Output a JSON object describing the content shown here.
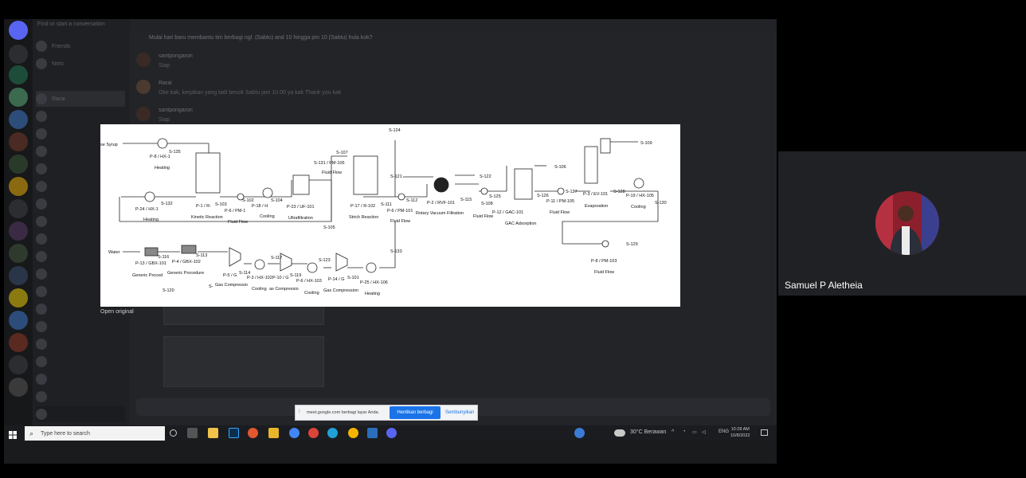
{
  "chat": {
    "title": "Mulai hari baru membantu tim berbagi ngl. (Sabtu) and 10 hingga pm 10 (Sabtu) hula kok?",
    "messages": [
      {
        "name": "santpongaron",
        "text": "Siap"
      },
      {
        "name": "Rarai",
        "text": "Oke kak, kerjakan yang tadi besok Sabtu jam 10.00 ya kak Thank you kak"
      },
      {
        "name": "santpongaron",
        "text": "Siap"
      }
    ]
  },
  "share_bar": {
    "text": "meet.google.com berbagi layar Anda.",
    "stop_label": "Hentikan berbagi",
    "hide_label": "Sembunyikan"
  },
  "open_original": "Open original",
  "participant": {
    "name": "Samuel P Aletheia"
  },
  "taskbar": {
    "search_placeholder": "Type here to search",
    "weather": "30°C Berawan",
    "language": "ENG",
    "time": "10:28 AM",
    "date": "10/8/2022"
  },
  "diagram": {
    "labels": {
      "syrup": "se Syrup",
      "s135": "S-135",
      "p8_hx": "P-8 / HX-1",
      "heating1": "Heating",
      "p24": "P-24 / HX-1",
      "s132": "S-132",
      "heating2": "Heating",
      "p1": "P-1 / R-",
      "kinetic": "Kinetic Reaction",
      "s103": "S-103",
      "pm_101": "P-6 / PM-1",
      "fluid1": "Fluid Flow",
      "s102": "S-102",
      "s104": "S-104",
      "p18": "P-18 / H",
      "cooling1": "Cooling",
      "p23": "P-23 / UF-101",
      "ultra": "Ultrafiltration",
      "s105": "S-105",
      "s131": "S-131 / PM-106",
      "s107": "S-107",
      "fluid2": "Fluid Flow",
      "p17": "P-17 / R-102",
      "starch": "Strich Reaction",
      "s111": "S-111",
      "pm101": "P-6 / PM-101",
      "fluid3": "Fluid Flow",
      "s124": "S-124",
      "s121": "S-121",
      "s112": "S-112",
      "p2": "P-2 / RVF-101",
      "rotary": "Rotary Vacuum Filtration",
      "s122": "S-122",
      "s115": "S-115",
      "s125": "S-125",
      "s108": "S-108",
      "fluid4": "Fluid Flow",
      "p12": "P-12 / GAC-101",
      "gac": "GAC Adsorption",
      "s106": "S-106",
      "s126": "S-126",
      "p11": "P-11 / PM-105",
      "fluid5": "Fluid Flow",
      "s127": "S-127",
      "p3": "P-3 / EV-101",
      "evap": "Evaporation",
      "s128": "S-128",
      "s109": "S-109",
      "p19": "P-19 / HX-105",
      "cooling2": "Cooling",
      "s130": "S-130",
      "s129": "S-129",
      "p8_pm": "P-8 / PM-103",
      "fluid6": "Fluid Flow",
      "water": "Water",
      "s116": "S-116",
      "p13": "P-13 / GBX-101",
      "generic1": "Generic Proced",
      "s120": "S-120",
      "s113": "S-113",
      "p4": "P-4 / GBX-102",
      "generic2": "Generic Procedure",
      "s_small": "S-",
      "p5": "P-5 / G",
      "s114": "S-114",
      "gascomp1": "Gas Compressio",
      "p102": "P-3 / HX-102",
      "cooling3": "Cooling",
      "s117": "S-117",
      "p10": "P-10 / G",
      "s119": "S-119",
      "gascomp2": "as Compressio",
      "p6_hx": "P-6 / HX-103",
      "cooling4": "Cooling",
      "s123": "S-123",
      "p14": "P-14 / G",
      "gascomp3": "Gas Compression",
      "s101": "S-101",
      "p25": "P-25 / HX-106",
      "heating3": "Heating",
      "s133": "S-133"
    }
  }
}
